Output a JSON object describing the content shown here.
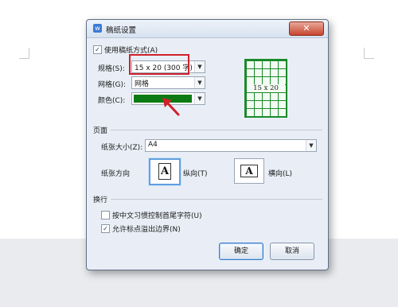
{
  "dialog": {
    "title": "稿纸设置",
    "close_symbol": "✕",
    "use_manuscript_label": "使用稿纸方式(A)",
    "use_manuscript_checked": true,
    "spec": {
      "label": "规格(S):",
      "value": "15 x 20 (300 字)"
    },
    "grid": {
      "label": "网格(G):",
      "value": "网格"
    },
    "color": {
      "label": "颜色(C):",
      "swatch": "#0c7a14"
    },
    "preview": {
      "label": "15 x 20"
    },
    "page_section": {
      "title": "页面",
      "paper_size_label": "纸张大小(Z):",
      "paper_size_value": "A4",
      "orientation_label": "纸张方向",
      "portrait_label": "纵向(T)",
      "landscape_label": "横向(L)",
      "orientation_selected": "portrait"
    },
    "wrap_section": {
      "title": "换行",
      "option1_label": "按中文习惯控制首尾字符(U)",
      "option1_checked": false,
      "option2_label": "允许标点溢出边界(N)",
      "option2_checked": true
    },
    "ok_label": "确定",
    "cancel_label": "取消"
  },
  "colors": {
    "highlight": "#d0202a",
    "accent": "#3b7bd6",
    "grid_green": "#1a8a2a"
  }
}
